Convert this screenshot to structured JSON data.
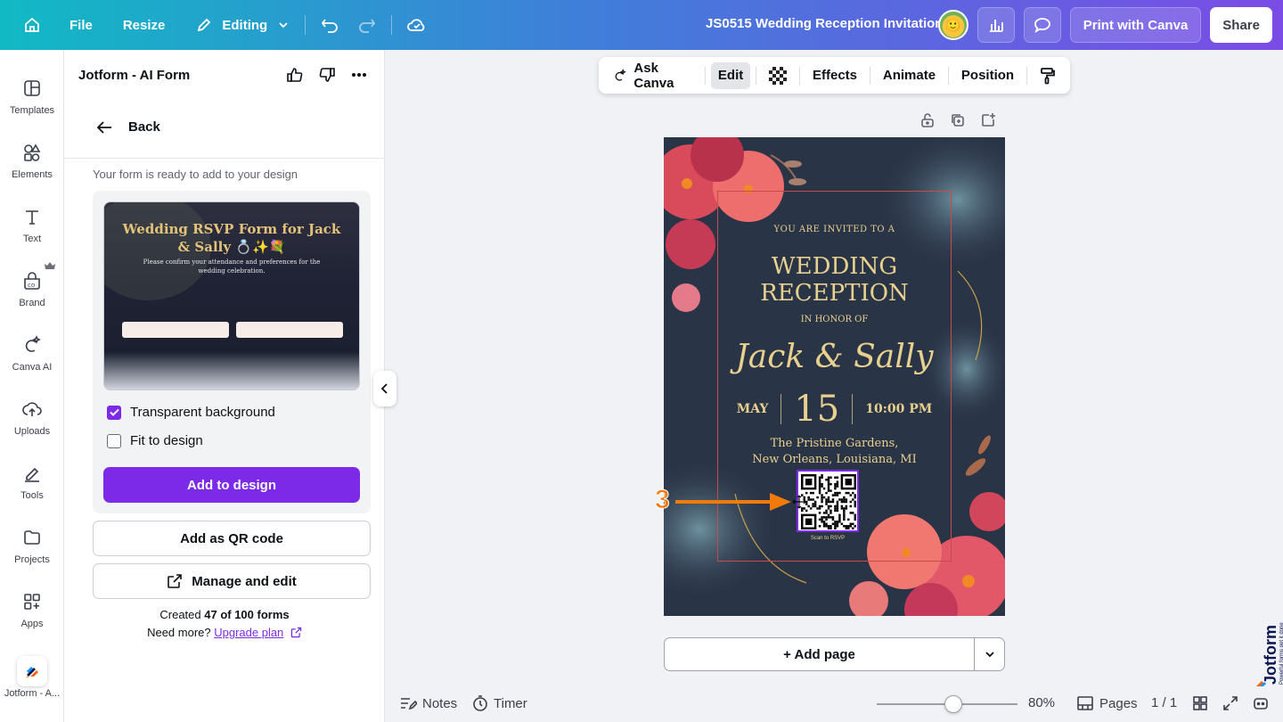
{
  "topbar": {
    "file": "File",
    "resize": "Resize",
    "editing": "Editing",
    "title": "JS0515 Wedding Reception Invitation",
    "print": "Print with Canva",
    "share": "Share"
  },
  "rail": {
    "items": [
      {
        "label": "Templates"
      },
      {
        "label": "Elements"
      },
      {
        "label": "Text"
      },
      {
        "label": "Brand"
      },
      {
        "label": "Canva AI"
      },
      {
        "label": "Uploads"
      },
      {
        "label": "Tools"
      },
      {
        "label": "Projects"
      },
      {
        "label": "Apps"
      }
    ],
    "app_label": "Jotform - A..."
  },
  "panel": {
    "title": "Jotform - AI Form",
    "back": "Back",
    "ready": "Your form is ready to add to your design",
    "preview": {
      "title": "Wedding RSVP Form for Jack & Sally 💍✨💐",
      "subtitle": "Please confirm your attendance and preferences for the wedding celebration."
    },
    "transparent_bg": "Transparent background",
    "transparent_checked": true,
    "fit_design": "Fit to design",
    "fit_checked": false,
    "add_to_design": "Add to design",
    "add_qr": "Add as QR code",
    "manage": "Manage and edit",
    "created_prefix": "Created ",
    "created_count": "47 of 100 forms",
    "need_more": "Need more? ",
    "upgrade": "Upgrade plan"
  },
  "context_toolbar": {
    "ask": "Ask Canva",
    "edit": "Edit",
    "effects": "Effects",
    "animate": "Animate",
    "position": "Position"
  },
  "invite": {
    "invited": "YOU ARE INVITED TO A",
    "line1": "WEDDING",
    "line2": "RECEPTION",
    "honor": "IN HONOR OF",
    "names": "Jack & Sally",
    "month": "MAY",
    "day": "15",
    "time": "10:00 PM",
    "venue1": "The Pristine Gardens,",
    "venue2": "New Orleans, Louisiana, MI",
    "scan": "Scan to RSVP"
  },
  "annotation": {
    "step": "3"
  },
  "canvas": {
    "add_page": "+ Add page"
  },
  "bottom": {
    "notes": "Notes",
    "timer": "Timer",
    "zoom": "80%",
    "pages": "Pages",
    "page_count": "1 / 1"
  },
  "branding": {
    "name": "Jotform",
    "tagline": "Powerful forms get it done"
  },
  "colors": {
    "accent": "#7d2ae8",
    "gold": "#e8d18e",
    "card": "#2a3447"
  }
}
